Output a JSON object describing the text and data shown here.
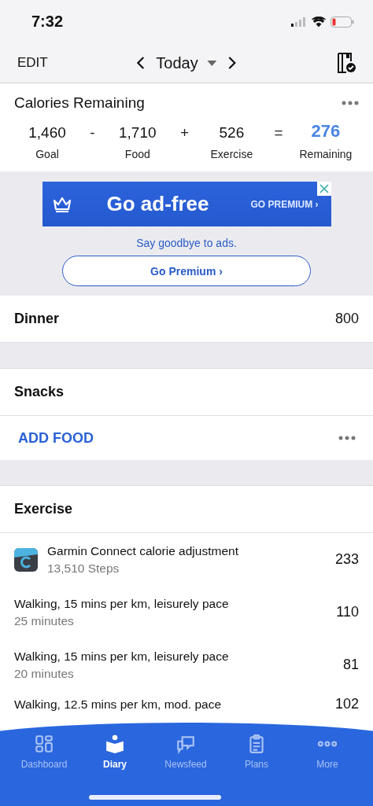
{
  "status_bar": {
    "time": "7:32"
  },
  "header": {
    "edit": "EDIT",
    "date": "Today"
  },
  "calories": {
    "title": "Calories Remaining",
    "terms": [
      {
        "kind": "value",
        "value": "1,460",
        "label": "Goal"
      },
      {
        "kind": "operator",
        "value": "-"
      },
      {
        "kind": "value",
        "value": "1,710",
        "label": "Food"
      },
      {
        "kind": "operator",
        "value": "+"
      },
      {
        "kind": "value",
        "value": "526",
        "label": "Exercise"
      },
      {
        "kind": "operator",
        "value": "="
      },
      {
        "kind": "result",
        "value": "276",
        "label": "Remaining"
      }
    ]
  },
  "ad": {
    "headline": "Go ad-free",
    "cta": "GO PREMIUM ›",
    "tagline": "Say goodbye to ads.",
    "button": "Go Premium ›"
  },
  "meals": [
    {
      "kind": "meal",
      "name": "Dinner",
      "calories": "800"
    },
    {
      "kind": "spacer"
    },
    {
      "kind": "meal",
      "name": "Snacks"
    },
    {
      "kind": "add",
      "label": "ADD FOOD"
    },
    {
      "kind": "spacer"
    }
  ],
  "exercise": {
    "title": "Exercise",
    "items": [
      {
        "kind": "app",
        "name": "Garmin Connect calorie adjustment",
        "detail": "13,510 Steps",
        "calories": "233"
      },
      {
        "kind": "plain",
        "name": "Walking, 15 mins per km, leisurely pace",
        "detail": "25 minutes",
        "calories": "110"
      },
      {
        "kind": "plain",
        "name": "Walking, 15 mins per km, leisurely pace",
        "detail": "20 minutes",
        "calories": "81"
      },
      {
        "kind": "plain",
        "name": "Walking, 12.5 mins per km, mod. pace",
        "calories": "102"
      }
    ]
  },
  "tabs": [
    {
      "label": "Dashboard",
      "selected": false
    },
    {
      "label": "Diary",
      "selected": true
    },
    {
      "label": "Newsfeed",
      "selected": false
    },
    {
      "label": "Plans",
      "selected": false
    },
    {
      "label": "More",
      "selected": false
    }
  ]
}
